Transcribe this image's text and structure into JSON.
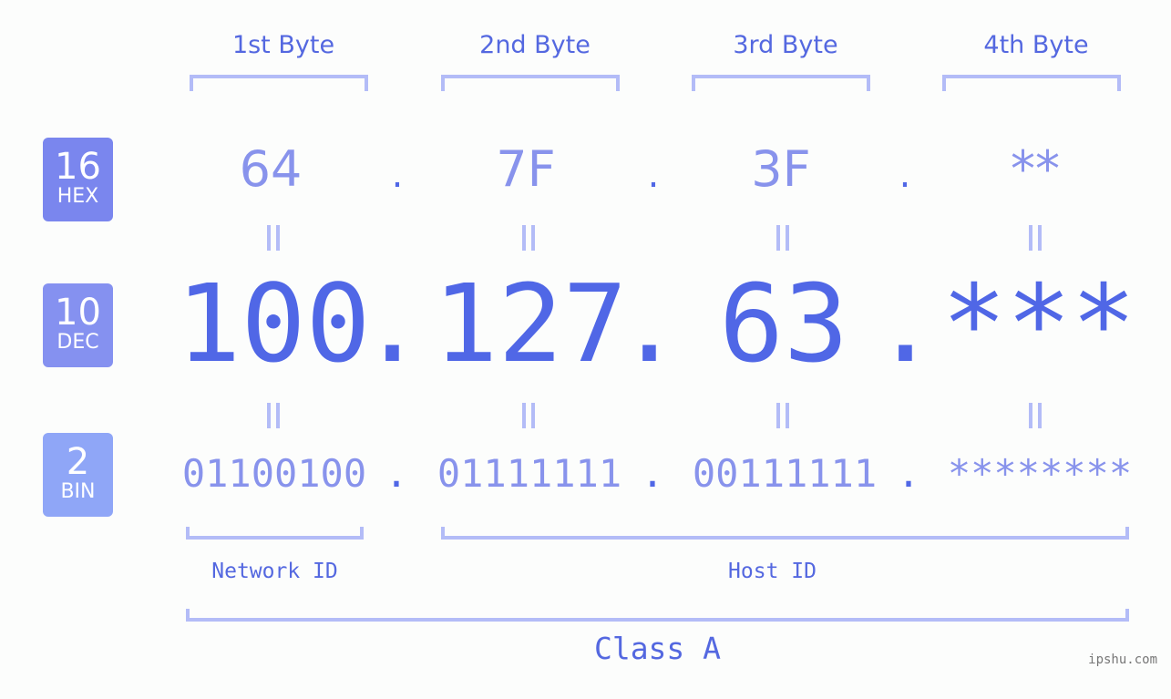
{
  "badges": [
    {
      "num": "16",
      "label": "HEX",
      "color": "#7a86ee"
    },
    {
      "num": "10",
      "label": "DEC",
      "color": "#8591f0"
    },
    {
      "num": "2",
      "label": "BIN",
      "color": "#8fa6f7"
    }
  ],
  "byte_headers": [
    "1st Byte",
    "2nd Byte",
    "3rd Byte",
    "4th Byte"
  ],
  "hex": [
    "64",
    "7F",
    "3F",
    "**"
  ],
  "dec": [
    "100",
    "127",
    "63",
    "***"
  ],
  "bin": [
    "01100100",
    "01111111",
    "00111111",
    "********"
  ],
  "separator": ".",
  "network_id_label": "Network ID",
  "host_id_label": "Host ID",
  "class_label": "Class A",
  "watermark": "ipshu.com",
  "colors": {
    "accent": "#5067e6",
    "light": "#8893ec",
    "bracket": "#b3bcf7"
  }
}
